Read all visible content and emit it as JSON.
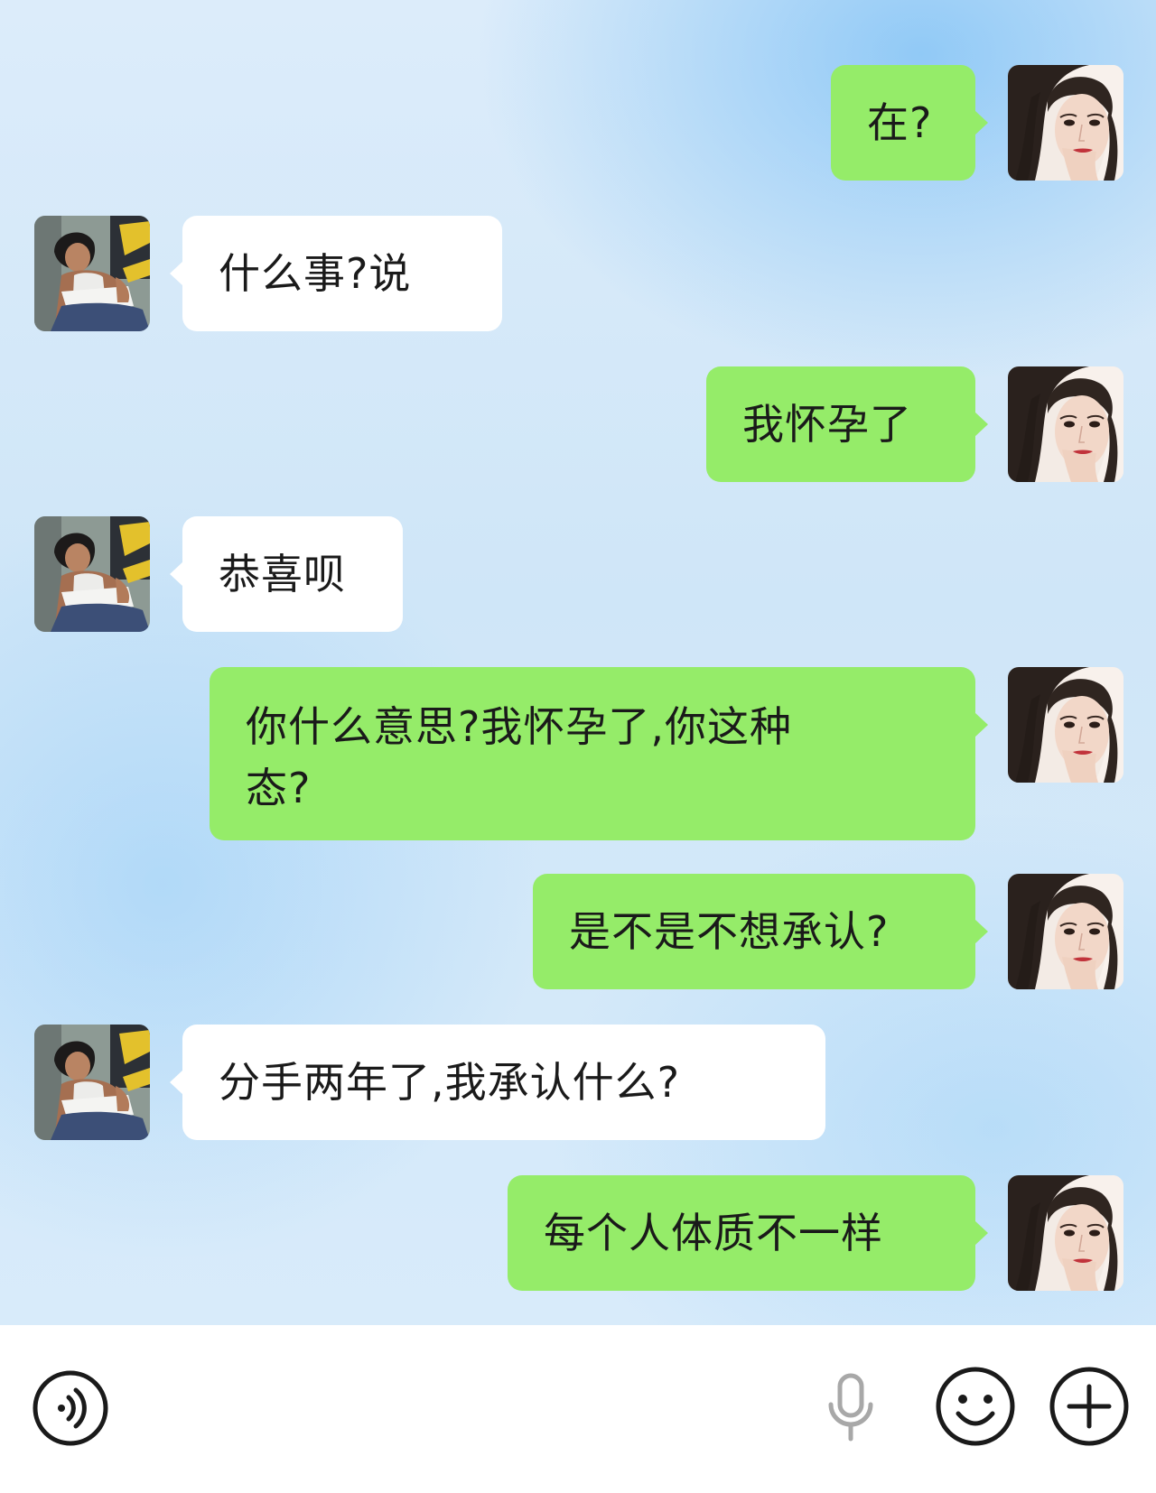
{
  "messages": [
    {
      "sender": "me",
      "text": "在?"
    },
    {
      "sender": "other",
      "text": "什么事?说"
    },
    {
      "sender": "me",
      "text": "我怀孕了"
    },
    {
      "sender": "other",
      "text": "恭喜呗"
    },
    {
      "sender": "me",
      "line1": "你什么意思?我怀孕了,你这种",
      "line2": "态?"
    },
    {
      "sender": "me",
      "text": "是不是不想承认?"
    },
    {
      "sender": "other",
      "text": "分手两年了,我承认什么?"
    },
    {
      "sender": "me",
      "text": "每个人体质不一样"
    }
  ],
  "input_bar": {
    "left_icon": "voice-icon",
    "right_icons": [
      "microphone-icon",
      "emoji-icon",
      "plus-icon"
    ]
  },
  "colors": {
    "my_bubble": "#95ec69",
    "their_bubble": "#ffffff",
    "input_bar": "#ffffff"
  }
}
